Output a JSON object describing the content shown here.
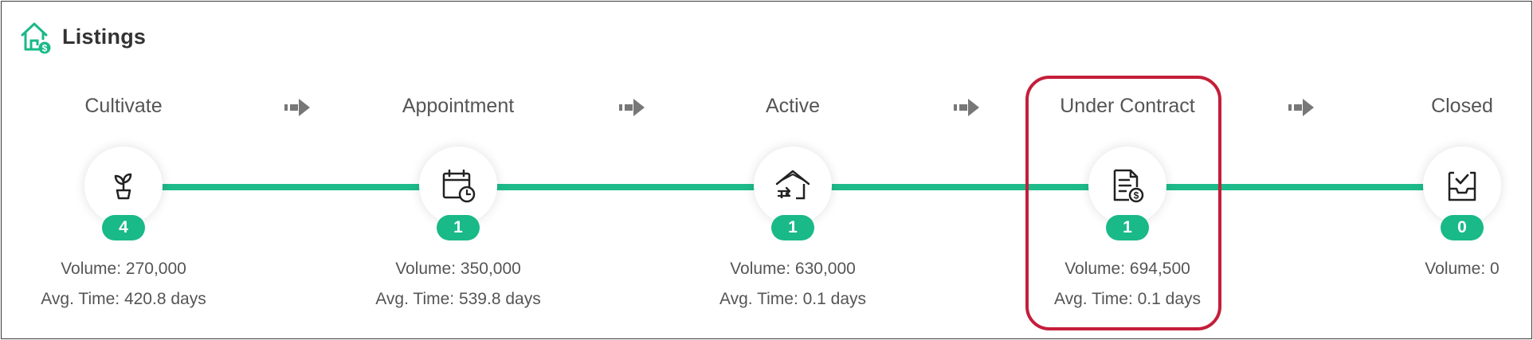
{
  "header": {
    "title": "Listings",
    "icon": "home-dollar-icon"
  },
  "colors": {
    "accent": "#1dbb8a",
    "highlight": "#c41e3a",
    "arrow": "#777777"
  },
  "pipeline": [
    {
      "name": "Cultivate",
      "icon": "sprout-icon",
      "count": "4",
      "volume": "Volume: 270,000",
      "avg_time": "Avg. Time: 420.8 days"
    },
    {
      "name": "Appointment",
      "icon": "calendar-clock-icon",
      "count": "1",
      "volume": "Volume: 350,000",
      "avg_time": "Avg. Time: 539.8 days"
    },
    {
      "name": "Active",
      "icon": "house-arrow-icon",
      "count": "1",
      "volume": "Volume: 630,000",
      "avg_time": "Avg. Time: 0.1 days"
    },
    {
      "name": "Under Contract",
      "icon": "document-dollar-icon",
      "count": "1",
      "volume": "Volume: 694,500",
      "avg_time": "Avg. Time: 0.1 days"
    },
    {
      "name": "Closed",
      "icon": "inbox-check-icon",
      "count": "0",
      "volume": "Volume: 0",
      "avg_time": ""
    }
  ]
}
